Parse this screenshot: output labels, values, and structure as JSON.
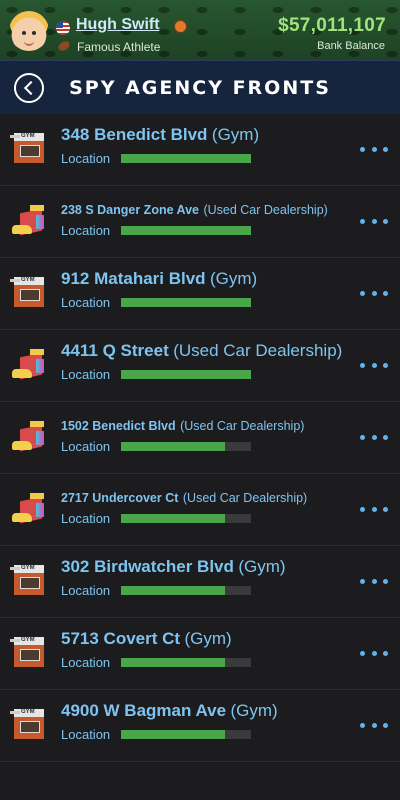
{
  "player": {
    "name": "Hugh Swift",
    "title": "Famous Athlete",
    "balance": "$57,011,107",
    "balance_label": "Bank Balance"
  },
  "header": {
    "title": "SPY AGENCY FRONTS"
  },
  "colors": {
    "accent": "#7ec4f0",
    "bar_fill": "#4aa64a",
    "header_bg": "#16243d",
    "balance": "#9fe57a"
  },
  "location_label": "Location",
  "fronts": [
    {
      "street": "348 Benedict Blvd",
      "type": "(Gym)",
      "kind": "gym-icon",
      "location_level": 1.0,
      "size": "big"
    },
    {
      "street": "238 S Danger Zone Ave",
      "type": "(Used Car Dealership)",
      "kind": "car-dealership-icon",
      "location_level": 1.0,
      "size": "small"
    },
    {
      "street": "912 Matahari Blvd",
      "type": "(Gym)",
      "kind": "gym-icon",
      "location_level": 1.0,
      "size": "big"
    },
    {
      "street": "4411 Q Street",
      "type": "(Used Car Dealership)",
      "kind": "car-dealership-icon",
      "location_level": 1.0,
      "size": "big"
    },
    {
      "street": "1502 Benedict Blvd",
      "type": "(Used Car Dealership)",
      "kind": "car-dealership-icon",
      "location_level": 0.8,
      "size": "small"
    },
    {
      "street": "2717 Undercover Ct",
      "type": "(Used Car Dealership)",
      "kind": "car-dealership-icon",
      "location_level": 0.8,
      "size": "small"
    },
    {
      "street": "302 Birdwatcher Blvd",
      "type": "(Gym)",
      "kind": "gym-icon",
      "location_level": 0.8,
      "size": "big"
    },
    {
      "street": "5713 Covert Ct",
      "type": "(Gym)",
      "kind": "gym-icon",
      "location_level": 0.8,
      "size": "big"
    },
    {
      "street": "4900 W Bagman Ave",
      "type": "(Gym)",
      "kind": "gym-icon",
      "location_level": 0.8,
      "size": "big"
    }
  ]
}
